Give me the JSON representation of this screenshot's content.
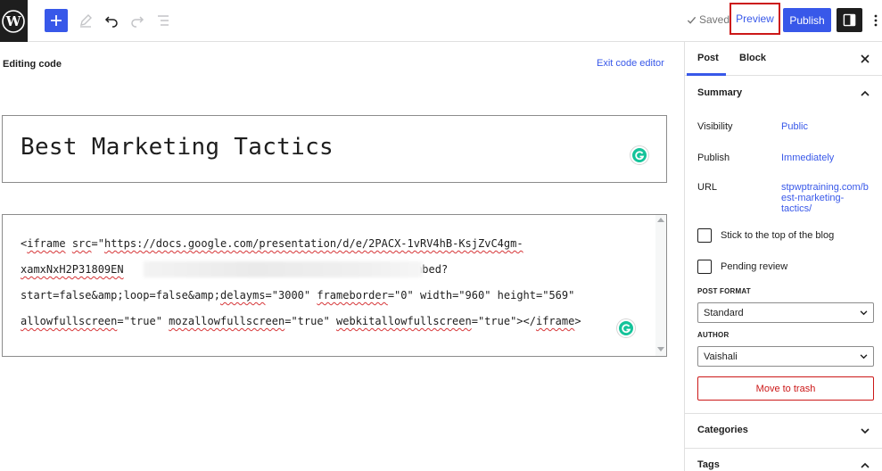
{
  "toolbar": {
    "saved_label": "Saved",
    "preview_label": "Preview",
    "publish_label": "Publish"
  },
  "editor": {
    "editing_label": "Editing code",
    "exit_label": "Exit code editor",
    "title": "Best Marketing Tactics",
    "code_lines": {
      "line1_prefix": "<",
      "line1_iframe": "iframe",
      "line1_sp": " ",
      "line1_src": "src",
      "line1_eq": "=\"",
      "line1_url": "https://docs.google.com/presentation/d/e/2PACX-1vRV4hB-KsjZvC4gm-",
      "line2_start": "xamxNxH2P31809EN",
      "line2_end": "/embed?",
      "line3_start": "start=false&amp;loop=false&amp;",
      "line3_delayms": "delayms",
      "line3_mid": "=\"3000\" ",
      "line3_frameborder": "frameborder",
      "line3_end": "=\"0\" width=\"960\" height=\"569\"",
      "line4_allow": "allowfullscreen",
      "line4_a": "=\"true\" ",
      "line4_moz": "mozallowfullscreen",
      "line4_b": "=\"true\" ",
      "line4_webkit": "webkitallowfullscreen",
      "line4_c": "=\"true\"></",
      "line4_iframe": "iframe",
      "line4_close": ">"
    }
  },
  "sidebar": {
    "tabs": {
      "post": "Post",
      "block": "Block"
    },
    "summary": {
      "heading": "Summary",
      "visibility_label": "Visibility",
      "visibility_value": "Public",
      "publish_label": "Publish",
      "publish_value": "Immediately",
      "url_label": "URL",
      "url_line1": "stpwptraining.com/b",
      "url_line2": "est-marketing-",
      "url_line3": "tactics/",
      "stick_label": "Stick to the top of the blog",
      "pending_label": "Pending review",
      "post_format_label": "POST FORMAT",
      "post_format_value": "Standard",
      "author_label": "AUTHOR",
      "author_value": "Vaishali",
      "trash_label": "Move to trash"
    },
    "categories_heading": "Categories",
    "tags_heading": "Tags"
  },
  "colors": {
    "accent": "#3858e9",
    "danger": "#cc1818",
    "dark": "#1e1e1e",
    "grammarly": "#15c39a"
  },
  "icons": [
    "wordpress-logo-icon",
    "plus-icon",
    "pencil-icon",
    "undo-icon",
    "redo-icon",
    "list-view-icon",
    "check-icon",
    "sidebar-toggle-icon",
    "more-vertical-icon",
    "close-icon",
    "chevron-up-icon",
    "chevron-down-icon",
    "grammarly-icon"
  ]
}
